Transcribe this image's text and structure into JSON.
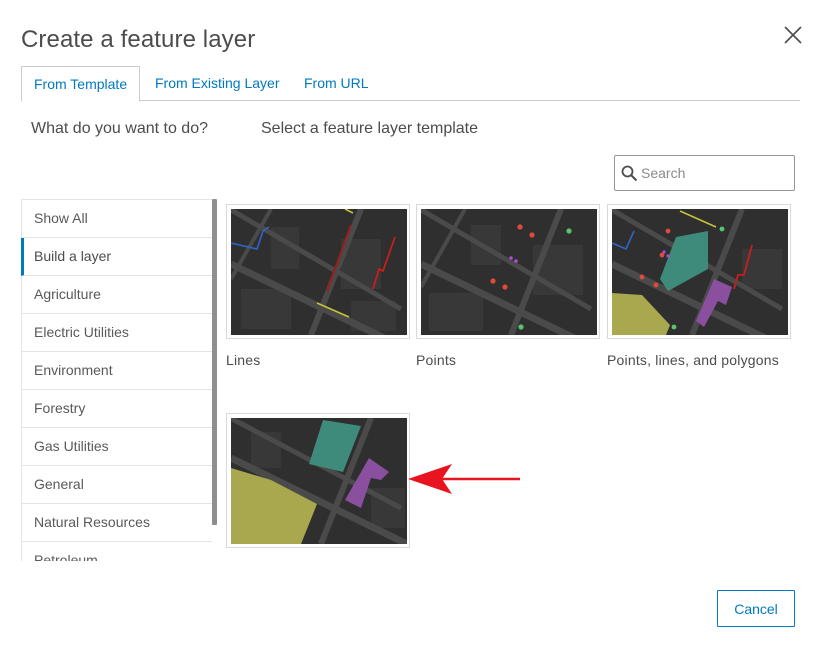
{
  "dialog": {
    "title": "Create a feature layer",
    "close_icon": "close-icon"
  },
  "tabs": [
    {
      "label": "From Template",
      "active": true
    },
    {
      "label": "From Existing Layer",
      "active": false
    },
    {
      "label": "From URL",
      "active": false
    }
  ],
  "steps": {
    "question": "What do you want to do?",
    "instruction": "Select a feature layer template"
  },
  "search": {
    "placeholder": "Search",
    "value": "",
    "icon": "search-icon"
  },
  "categories": [
    {
      "label": "Show All",
      "selected": false
    },
    {
      "label": "Build a layer",
      "selected": true
    },
    {
      "label": "Agriculture",
      "selected": false
    },
    {
      "label": "Electric Utilities",
      "selected": false
    },
    {
      "label": "Environment",
      "selected": false
    },
    {
      "label": "Forestry",
      "selected": false
    },
    {
      "label": "Gas Utilities",
      "selected": false
    },
    {
      "label": "General",
      "selected": false
    },
    {
      "label": "Natural Resources",
      "selected": false
    },
    {
      "label": "Petroleum",
      "selected": false
    }
  ],
  "templates": [
    {
      "label": "Lines"
    },
    {
      "label": "Points"
    },
    {
      "label": "Points, lines, and polygons"
    },
    {
      "label": ""
    }
  ],
  "footer": {
    "cancel_label": "Cancel"
  },
  "colors": {
    "accent": "#0079c1",
    "map_background": "#2f2f2f",
    "road": "#4a4a4a",
    "polygon_teal": "#3f8b7b",
    "polygon_purple": "#8a4f9e",
    "polygon_yellow": "#a9a84f",
    "annotation_arrow": "#e8141f"
  }
}
